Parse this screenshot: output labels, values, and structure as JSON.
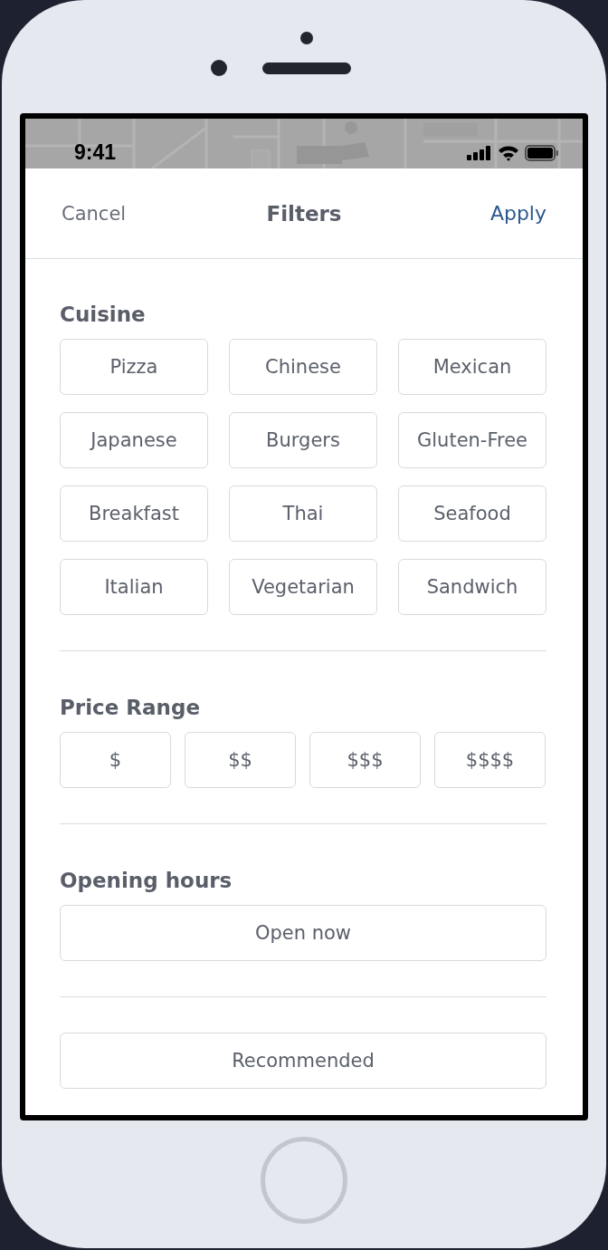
{
  "status_bar": {
    "time": "9:41"
  },
  "header": {
    "cancel": "Cancel",
    "title": "Filters",
    "apply": "Apply"
  },
  "sections": [
    {
      "title": "Cuisine",
      "kind": "grid3",
      "options": [
        "Pizza",
        "Chinese",
        "Mexican",
        "Japanese",
        "Burgers",
        "Gluten-Free",
        "Breakfast",
        "Thai",
        "Seafood",
        "Italian",
        "Vegetarian",
        "Sandwich"
      ]
    },
    {
      "title": "Price Range",
      "kind": "grid4",
      "options": [
        "$",
        "$$",
        "$$$",
        "$$$$"
      ]
    },
    {
      "title": "Opening hours",
      "kind": "wide",
      "options": [
        "Open now"
      ]
    },
    {
      "kind": "wide",
      "options": [
        "Recommended"
      ]
    }
  ]
}
